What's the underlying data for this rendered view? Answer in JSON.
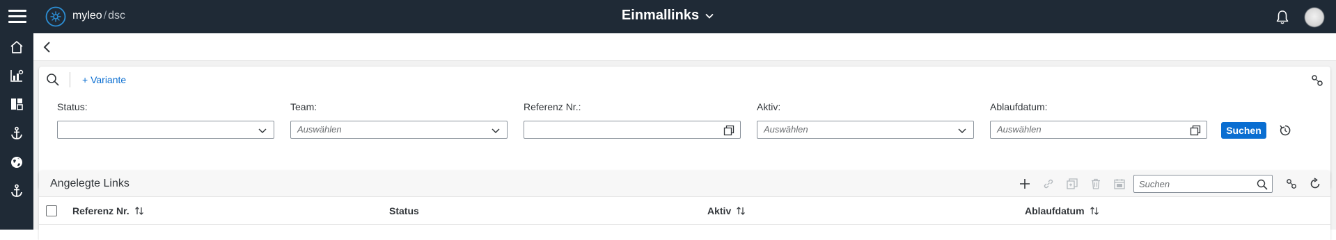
{
  "header": {
    "brand_main": "myleo",
    "brand_sep": "/",
    "brand_sub": "dsc",
    "title": "Einmallinks",
    "icons": [
      "menu-icon",
      "logo-icon",
      "chevron-down-icon",
      "bell-icon",
      "avatar"
    ]
  },
  "sidebar": {
    "items": [
      {
        "icon": "home-icon"
      },
      {
        "icon": "bar-chart-icon"
      },
      {
        "icon": "dashboard-icon"
      },
      {
        "icon": "anchor-icon"
      },
      {
        "icon": "globe-icon"
      },
      {
        "icon": "anchor-icon"
      }
    ]
  },
  "filterbar": {
    "variant_label": "+ Variante",
    "fields": [
      {
        "label": "Status:",
        "value": ""
      },
      {
        "label": "Team:",
        "placeholder": "Auswählen"
      },
      {
        "label": "Referenz Nr.:",
        "value": ""
      },
      {
        "label": "Aktiv:",
        "placeholder": "Auswählen"
      },
      {
        "label": "Ablaufdatum:",
        "placeholder": "Auswählen"
      }
    ],
    "search_button": "Suchen"
  },
  "table": {
    "title": "Angelegte Links",
    "search_placeholder": "Suchen",
    "columns": [
      {
        "label": "Referenz Nr.",
        "sortable": true
      },
      {
        "label": "Status",
        "sortable": false
      },
      {
        "label": "Aktiv",
        "sortable": true
      },
      {
        "label": "Ablaufdatum",
        "sortable": true
      }
    ]
  },
  "colors": {
    "shell": "#1f2a36",
    "accent": "#0a6ed1",
    "background": "#f2f2f2"
  }
}
